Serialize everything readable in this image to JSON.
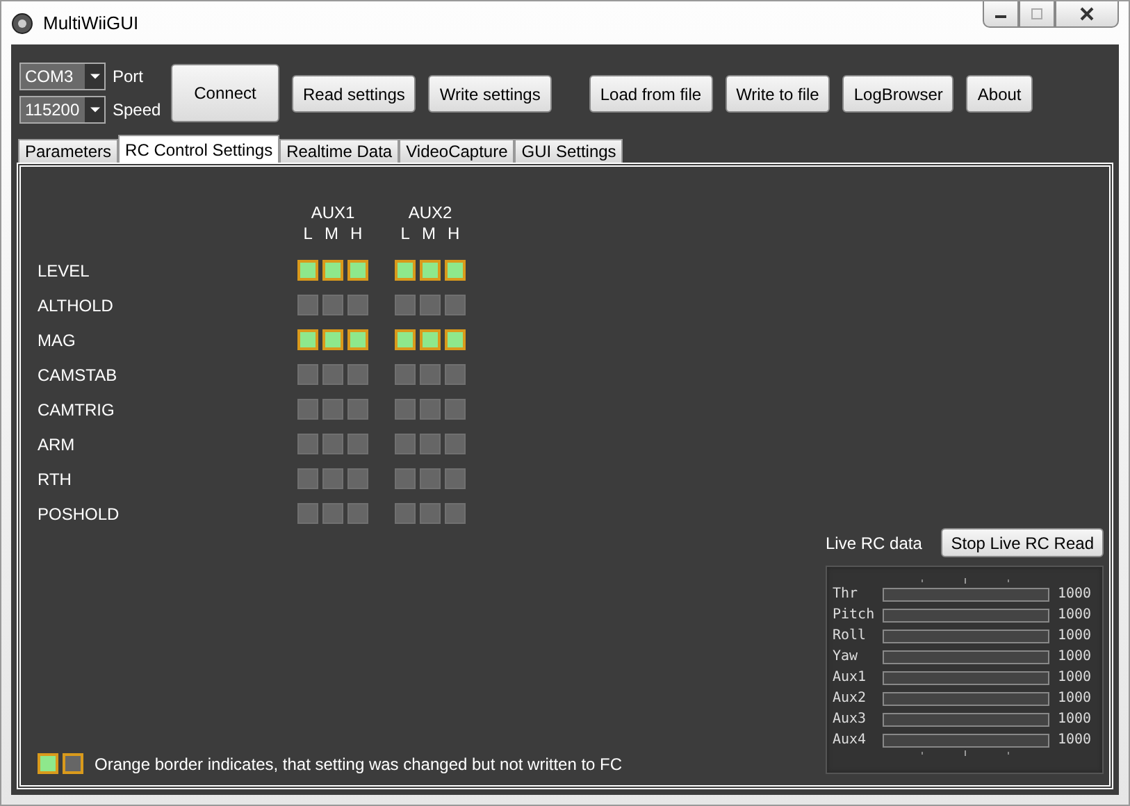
{
  "window": {
    "title": "MultiWiiGUI"
  },
  "connection": {
    "port": {
      "value": "COM3",
      "label": "Port"
    },
    "speed": {
      "value": "115200",
      "label": "Speed"
    }
  },
  "buttons": [
    {
      "label": "Connect",
      "kind": "large"
    },
    {
      "label": "Read settings",
      "kind": "normal"
    },
    {
      "label": "Write settings",
      "kind": "normal"
    },
    {
      "label": "Load from file",
      "kind": "normal"
    },
    {
      "label": "Write to file",
      "kind": "normal"
    },
    {
      "label": "LogBrowser",
      "kind": "normal"
    },
    {
      "label": "About",
      "kind": "normal"
    }
  ],
  "tabs": [
    {
      "label": "Parameters",
      "selected": false
    },
    {
      "label": "RC Control Settings",
      "selected": true
    },
    {
      "label": "Realtime Data",
      "selected": false
    },
    {
      "label": "VideoCapture",
      "selected": false
    },
    {
      "label": "GUI Settings",
      "selected": false
    }
  ],
  "aux_columns": [
    {
      "name": "AUX1",
      "levels": [
        "L",
        "M",
        "H"
      ]
    },
    {
      "name": "AUX2",
      "levels": [
        "L",
        "M",
        "H"
      ]
    }
  ],
  "modes": [
    {
      "name": "LEVEL",
      "aux": [
        [
          {
            "checked": true,
            "changed": true
          },
          {
            "checked": true,
            "changed": true
          },
          {
            "checked": true,
            "changed": true
          }
        ],
        [
          {
            "checked": true,
            "changed": true
          },
          {
            "checked": true,
            "changed": true
          },
          {
            "checked": true,
            "changed": true
          }
        ]
      ]
    },
    {
      "name": "ALTHOLD",
      "aux": [
        [
          {
            "checked": false,
            "changed": false
          },
          {
            "checked": false,
            "changed": false
          },
          {
            "checked": false,
            "changed": false
          }
        ],
        [
          {
            "checked": false,
            "changed": false
          },
          {
            "checked": false,
            "changed": false
          },
          {
            "checked": false,
            "changed": false
          }
        ]
      ]
    },
    {
      "name": "MAG",
      "aux": [
        [
          {
            "checked": true,
            "changed": true
          },
          {
            "checked": true,
            "changed": true
          },
          {
            "checked": true,
            "changed": true
          }
        ],
        [
          {
            "checked": true,
            "changed": true
          },
          {
            "checked": true,
            "changed": true
          },
          {
            "checked": true,
            "changed": true
          }
        ]
      ]
    },
    {
      "name": "CAMSTAB",
      "aux": [
        [
          {
            "checked": false,
            "changed": false
          },
          {
            "checked": false,
            "changed": false
          },
          {
            "checked": false,
            "changed": false
          }
        ],
        [
          {
            "checked": false,
            "changed": false
          },
          {
            "checked": false,
            "changed": false
          },
          {
            "checked": false,
            "changed": false
          }
        ]
      ]
    },
    {
      "name": "CAMTRIG",
      "aux": [
        [
          {
            "checked": false,
            "changed": false
          },
          {
            "checked": false,
            "changed": false
          },
          {
            "checked": false,
            "changed": false
          }
        ],
        [
          {
            "checked": false,
            "changed": false
          },
          {
            "checked": false,
            "changed": false
          },
          {
            "checked": false,
            "changed": false
          }
        ]
      ]
    },
    {
      "name": "ARM",
      "aux": [
        [
          {
            "checked": false,
            "changed": false
          },
          {
            "checked": false,
            "changed": false
          },
          {
            "checked": false,
            "changed": false
          }
        ],
        [
          {
            "checked": false,
            "changed": false
          },
          {
            "checked": false,
            "changed": false
          },
          {
            "checked": false,
            "changed": false
          }
        ]
      ]
    },
    {
      "name": "RTH",
      "aux": [
        [
          {
            "checked": false,
            "changed": false
          },
          {
            "checked": false,
            "changed": false
          },
          {
            "checked": false,
            "changed": false
          }
        ],
        [
          {
            "checked": false,
            "changed": false
          },
          {
            "checked": false,
            "changed": false
          },
          {
            "checked": false,
            "changed": false
          }
        ]
      ]
    },
    {
      "name": "POSHOLD",
      "aux": [
        [
          {
            "checked": false,
            "changed": false
          },
          {
            "checked": false,
            "changed": false
          },
          {
            "checked": false,
            "changed": false
          }
        ],
        [
          {
            "checked": false,
            "changed": false
          },
          {
            "checked": false,
            "changed": false
          },
          {
            "checked": false,
            "changed": false
          }
        ]
      ]
    }
  ],
  "legend": {
    "boxes": [
      {
        "checked": true,
        "changed": true
      },
      {
        "checked": false,
        "changed": true
      }
    ],
    "text": "Orange border indicates, that setting was changed but not written to FC"
  },
  "live_rc": {
    "label": "Live RC data",
    "button": "Stop Live RC Read",
    "channels": [
      {
        "name": "Thr",
        "level": 0,
        "reading": "1000"
      },
      {
        "name": "Pitch",
        "level": 0,
        "reading": "1000"
      },
      {
        "name": "Roll",
        "level": 0,
        "reading": "1000"
      },
      {
        "name": "Yaw",
        "level": 0,
        "reading": "1000"
      },
      {
        "name": "Aux1",
        "level": 0,
        "reading": "1000"
      },
      {
        "name": "Aux2",
        "level": 0,
        "reading": "1000"
      },
      {
        "name": "Aux3",
        "level": 0,
        "reading": "1000"
      },
      {
        "name": "Aux4",
        "level": 0,
        "reading": "1000"
      }
    ]
  }
}
